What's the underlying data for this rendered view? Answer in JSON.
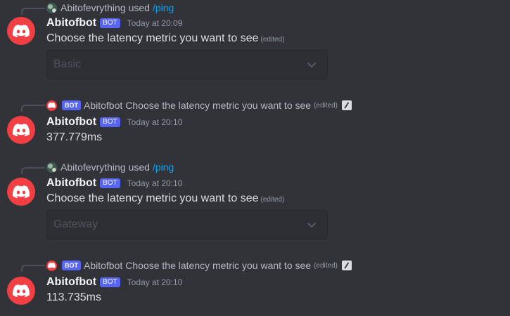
{
  "messages": [
    {
      "reply": {
        "type": "command",
        "user": "Abitofevrything",
        "used": "used",
        "command": "/ping"
      },
      "author": "Abitofbot",
      "tag": "BOT",
      "timestamp": "Today at 20:09",
      "content": "Choose the latency metric you want to see",
      "edited": "(edited)",
      "select": {
        "value": "Basic"
      }
    },
    {
      "reply": {
        "type": "message",
        "tag": "BOT",
        "author": "Abitofbot",
        "text": "Choose the latency metric you want to see",
        "edited": "(edited)"
      },
      "author": "Abitofbot",
      "tag": "BOT",
      "timestamp": "Today at 20:10",
      "content": "377.779ms"
    },
    {
      "reply": {
        "type": "command",
        "user": "Abitofevrything",
        "used": "used",
        "command": "/ping"
      },
      "author": "Abitofbot",
      "tag": "BOT",
      "timestamp": "Today at 20:10",
      "content": "Choose the latency metric you want to see",
      "edited": "(edited)",
      "select": {
        "value": "Gateway"
      }
    },
    {
      "reply": {
        "type": "message",
        "tag": "BOT",
        "author": "Abitofbot",
        "text": "Choose the latency metric you want to see",
        "edited": "(edited)"
      },
      "author": "Abitofbot",
      "tag": "BOT",
      "timestamp": "Today at 20:10",
      "content": "113.735ms"
    }
  ],
  "colors": {
    "background": "#313338",
    "avatar": "#f23f43",
    "bot_tag": "#5865f2",
    "command_link": "#00a8fc"
  },
  "icons": {
    "avatar": "discord-logo-icon",
    "select_chevron": "chevron-down-icon",
    "app_command": "slash-command-icon"
  }
}
